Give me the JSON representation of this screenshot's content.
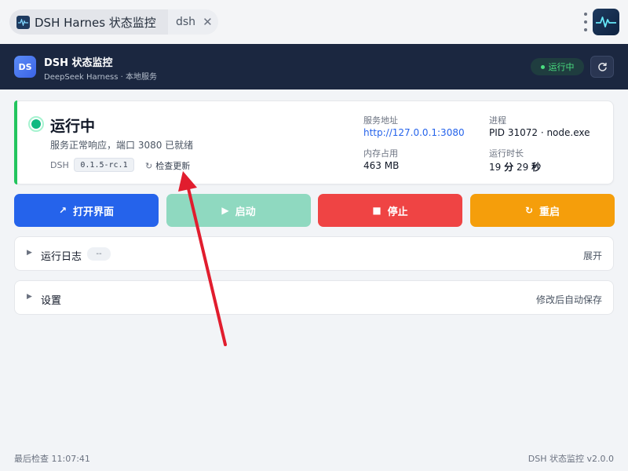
{
  "window": {
    "tabs": [
      {
        "title": "DSH Harnes 状态监控",
        "active": true
      },
      {
        "title": "dsh",
        "active": false
      }
    ],
    "close_icon": "close-icon",
    "menu_icon": "kebab-menu-icon",
    "app_icon": "pulse-icon"
  },
  "header": {
    "logo_text": "DS",
    "title": "DSH 状态监控",
    "subtitle": "DeepSeek Harness · 本地服务",
    "status_pill": "运行中",
    "refresh_icon": "refresh-icon"
  },
  "status": {
    "title": "运行中",
    "description": "服务正常响应，端口 3080 已就绪",
    "version_label": "DSH",
    "version": "0.1.5-rc.1",
    "check_update": "检查更新",
    "check_update_icon": "refresh-icon",
    "meta": {
      "address_label": "服务地址",
      "address": "http://127.0.0.1:3080",
      "process_label": "进程",
      "process": "PID 31072 · node.exe",
      "memory_label": "内存占用",
      "memory": "463 MB",
      "uptime_label": "运行时长",
      "uptime_min": "19",
      "uptime_min_unit": "分",
      "uptime_sec": "29",
      "uptime_sec_unit": "秒"
    }
  },
  "actions": {
    "open": {
      "label": "打开界面",
      "icon": "external-arrow-icon"
    },
    "start": {
      "label": "启动",
      "icon": "play-icon"
    },
    "stop": {
      "label": "停止",
      "icon": "stop-icon"
    },
    "restart": {
      "label": "重启",
      "icon": "refresh-icon"
    }
  },
  "panels": {
    "log": {
      "title": "运行日志",
      "badge": "--",
      "right": "展开"
    },
    "settings": {
      "title": "设置",
      "right": "修改后自动保存"
    }
  },
  "footer": {
    "last_check": "最后检查 11:07:41",
    "version": "DSH 状态监控 v2.0.0"
  },
  "colors": {
    "accent": "#2563eb",
    "running": "#10b981",
    "stop": "#ef4444",
    "restart": "#f59e0b",
    "start_disabled": "#8fd9c0",
    "header_bg": "#1b2740",
    "annotation_arrow": "#e11d2e"
  }
}
